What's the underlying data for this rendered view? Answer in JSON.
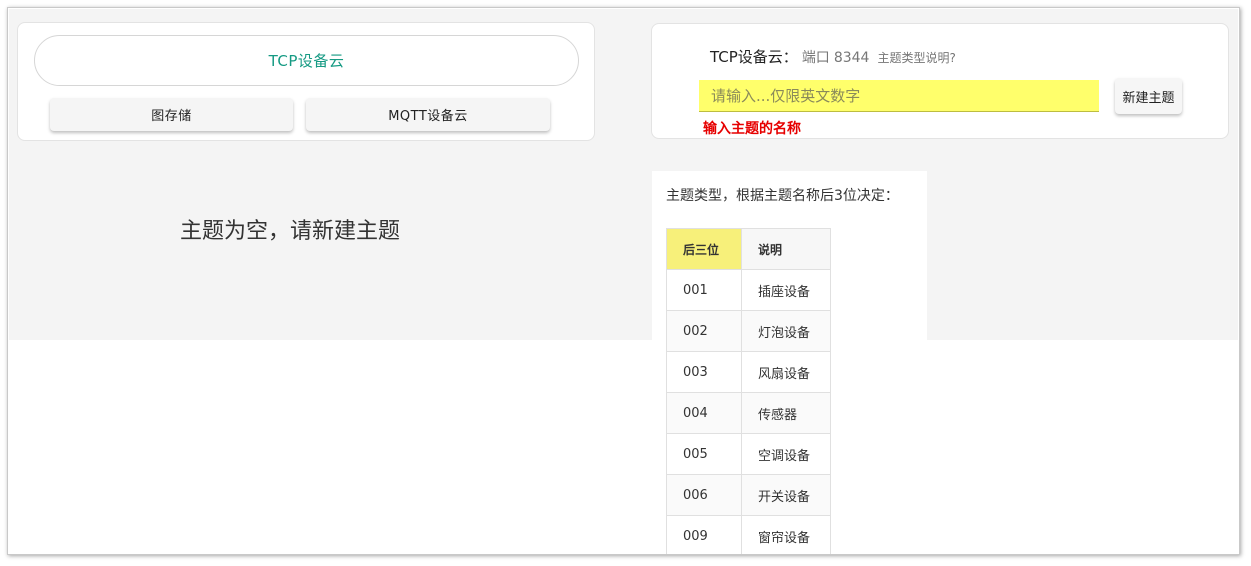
{
  "left_card": {
    "main_button": "TCP设备云",
    "image_store_button": "图存储",
    "mqtt_button": "MQTT设备云"
  },
  "right_card": {
    "title": "TCP设备云：",
    "port_label": "端口",
    "port": "8344",
    "help_link": "主题类型说明?",
    "input": {
      "value": "",
      "placeholder": "请输入...仅限英文数字"
    },
    "new_topic_button": "新建主题",
    "hint": "输入主题的名称",
    "accent_color": "#ffff6b",
    "hint_color": "#e60000"
  },
  "empty_message": "主题为空，请新建主题",
  "topic_types": {
    "description": "主题类型，根据主题名称后3位决定：",
    "headers": [
      "后三位",
      "说明"
    ],
    "rows": [
      [
        "001",
        "插座设备"
      ],
      [
        "002",
        "灯泡设备"
      ],
      [
        "003",
        "风扇设备"
      ],
      [
        "004",
        "传感器"
      ],
      [
        "005",
        "空调设备"
      ],
      [
        "006",
        "开关设备"
      ],
      [
        "009",
        "窗帘设备"
      ]
    ]
  }
}
